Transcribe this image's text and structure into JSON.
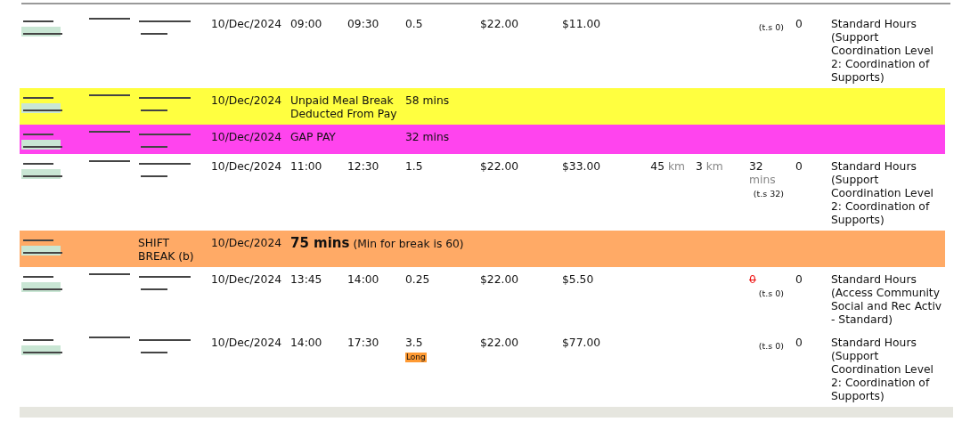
{
  "rows": [
    {
      "kind": "shift",
      "date": "10/Dec/2024",
      "start": "09:00",
      "end": "09:30",
      "hours": "0.5",
      "rate": "$22.00",
      "total": "$11.00",
      "ts": "(t.s 0)",
      "count": "0",
      "description": "Standard Hours (Support Coordination Level 2: Coordination of Supports)"
    },
    {
      "kind": "adjustment",
      "color": "#ffff40",
      "date": "10/Dec/2024",
      "label": "Unpaid Meal Break Deducted From Pay",
      "amount": "58 mins"
    },
    {
      "kind": "adjustment",
      "color": "#ff44ee",
      "date": "10/Dec/2024",
      "label": "GAP PAY",
      "amount": "32 mins"
    },
    {
      "kind": "shift",
      "date": "10/Dec/2024",
      "start": "11:00",
      "end": "12:30",
      "hours": "1.5",
      "rate": "$22.00",
      "total": "$33.00",
      "km": {
        "value": "45",
        "unit": "km"
      },
      "km2": {
        "value": "3",
        "unit": "km"
      },
      "travel": {
        "value": "32",
        "unit": "mins",
        "struck": false
      },
      "ts": "(t.s 32)",
      "count": "0",
      "description": "Standard Hours (Support Coordination Level 2: Coordination of Supports)"
    },
    {
      "kind": "break",
      "color": "#ffaa66",
      "type_label": "SHIFT BREAK (b)",
      "date": "10/Dec/2024",
      "amount": "75 mins",
      "note": "(Min for break is 60)"
    },
    {
      "kind": "shift",
      "date": "10/Dec/2024",
      "start": "13:45",
      "end": "14:00",
      "hours": "0.25",
      "rate": "$22.00",
      "total": "$5.50",
      "travel": {
        "value": "0",
        "struck": true
      },
      "ts": "(t.s 0)",
      "count": "0",
      "description": "Standard Hours (Access Community Social and Rec Activ - Standard)"
    },
    {
      "kind": "shift",
      "date": "10/Dec/2024",
      "start": "14:00",
      "end": "17:30",
      "hours": "3.5",
      "hours_badge": "Long",
      "rate": "$22.00",
      "total": "$77.00",
      "ts": "(t.s 0)",
      "count": "0",
      "description": "Standard Hours (Support Coordination Level 2: Coordination of Supports)"
    }
  ]
}
